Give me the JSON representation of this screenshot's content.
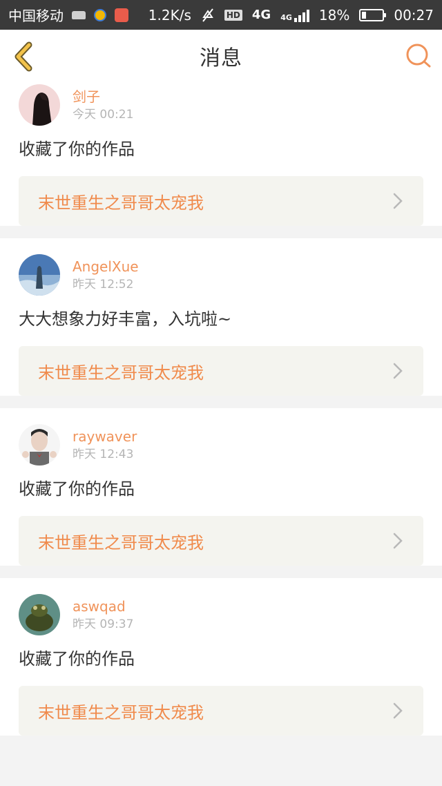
{
  "status_bar": {
    "carrier": "中国移动",
    "speed": "1.2K/s",
    "hd": "HD",
    "net1": "4G",
    "net2": "4G",
    "battery": "18%",
    "time": "00:27"
  },
  "navbar": {
    "title": "消息"
  },
  "messages": [
    {
      "name": "剑子",
      "time": "今天 00:21",
      "content": "收藏了你的作品",
      "work": "末世重生之哥哥太宠我"
    },
    {
      "name": "AngelXue",
      "time": "昨天 12:52",
      "content": "大大想象力好丰富，入坑啦~",
      "work": "末世重生之哥哥太宠我"
    },
    {
      "name": "raywaver",
      "time": "昨天 12:43",
      "content": "收藏了你的作品",
      "work": "末世重生之哥哥太宠我"
    },
    {
      "name": "aswqad",
      "time": "昨天 09:37",
      "content": "收藏了你的作品",
      "work": "末世重生之哥哥太宠我"
    }
  ],
  "colors": {
    "accent": "#f0935a",
    "link_bg": "#f4f4ef",
    "status_bar_bg": "#3a3a3a",
    "back_icon": "#f2c24a"
  },
  "icons": [
    "back-arrow-icon",
    "search-icon",
    "chevron-right-icon"
  ]
}
